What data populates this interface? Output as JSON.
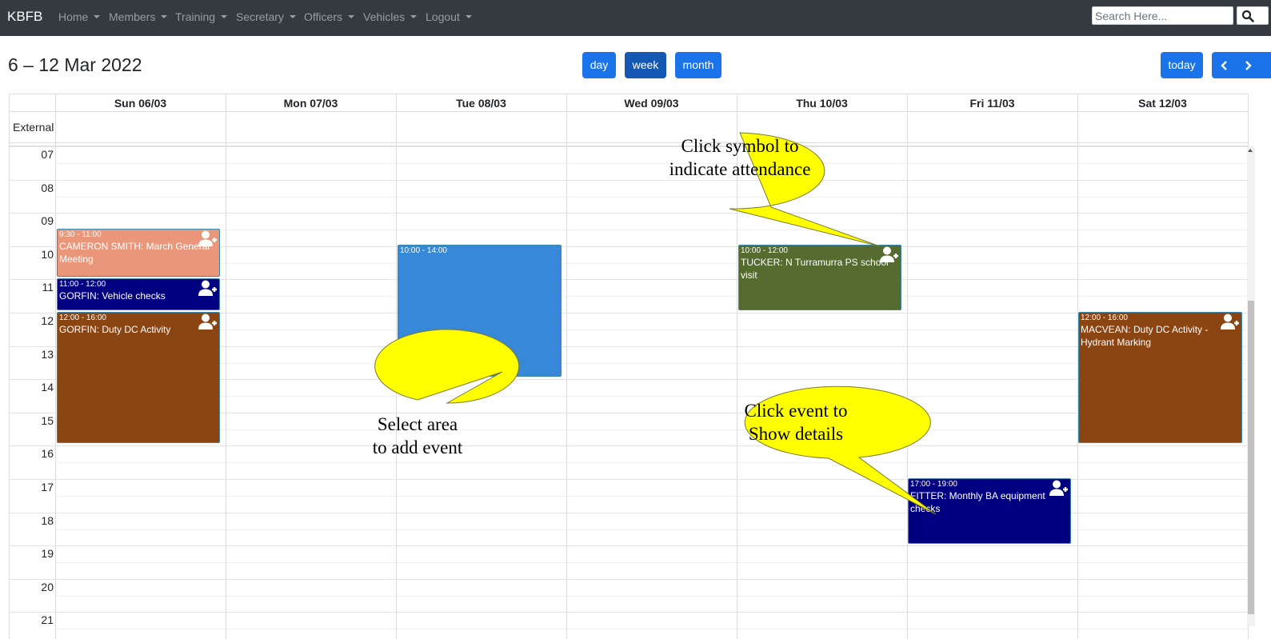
{
  "navbar": {
    "brand": "KBFB",
    "items": [
      "Home",
      "Members",
      "Training",
      "Secretary",
      "Officers",
      "Vehicles",
      "Logout"
    ],
    "search_placeholder": "Search Here...",
    "search_icon": "search-icon"
  },
  "toolbar": {
    "title": "6 – 12 Mar 2022",
    "view_buttons": [
      "day",
      "week",
      "month"
    ],
    "active_view": "week",
    "today_label": "today",
    "prev_icon": "chevron-left-icon",
    "next_icon": "chevron-right-icon"
  },
  "calendar": {
    "day_headers": [
      "Sun 06/03",
      "Mon 07/03",
      "Tue 08/03",
      "Wed 09/03",
      "Thu 10/03",
      "Fri 11/03",
      "Sat 12/03"
    ],
    "all_day_label": "External",
    "hours": [
      "07",
      "08",
      "09",
      "10",
      "11",
      "12",
      "13",
      "14",
      "15",
      "16",
      "17",
      "18",
      "19",
      "20",
      "21"
    ]
  },
  "events": [
    {
      "day": "Sun 06/03",
      "time": "9:30 - 11:00",
      "title": "CAMERON SMITH: March General Meeting",
      "color": "#e9967a",
      "attend_icon": "user-plus-icon"
    },
    {
      "day": "Sun 06/03",
      "time": "11:00 - 12:00",
      "title": "GORFIN: Vehicle checks",
      "color": "#000080",
      "attend_icon": "user-plus-icon"
    },
    {
      "day": "Sun 06/03",
      "time": "12:00 - 16:00",
      "title": "GORFIN: Duty DC Activity",
      "color": "#8b4513",
      "attend_icon": "user-plus-icon"
    },
    {
      "day": "Tue 08/03",
      "time": "10:00 - 14:00",
      "title": "",
      "color": "#3788d8"
    },
    {
      "day": "Thu 10/03",
      "time": "10:00 - 12:00",
      "title": "TUCKER: N Turramurra PS school visit",
      "color": "#556b2f",
      "attend_icon": "user-plus-icon"
    },
    {
      "day": "Fri 11/03",
      "time": "17:00 - 19:00",
      "title": "FITTER: Monthly BA equipment checks",
      "color": "#000080",
      "attend_icon": "user-plus-icon"
    },
    {
      "day": "Sat 12/03",
      "time": "12:00 - 16:00",
      "title": "MACVEAN: Duty DC Activity - Hydrant Marking",
      "color": "#8b4513",
      "attend_icon": "user-plus-icon"
    }
  ],
  "callouts": [
    {
      "line1": "Click symbol to",
      "line2": "indicate attendance"
    },
    {
      "line1": "Select area",
      "line2": "to add event"
    },
    {
      "line1": "Click event to",
      "line2": "Show details"
    }
  ],
  "colors": {
    "navbar_bg": "#343a40",
    "button_primary": "#1a73e8",
    "button_active": "#1558b3",
    "callout_fill": "#ffff00"
  }
}
